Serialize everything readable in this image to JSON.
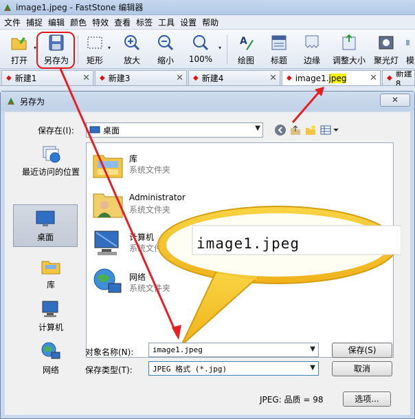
{
  "window": {
    "title": "image1.jpeg - FastStone 编辑器"
  },
  "menu": [
    "文件",
    "捕捉",
    "编辑",
    "颜色",
    "特效",
    "查看",
    "标签",
    "工具",
    "设置",
    "帮助"
  ],
  "toolbar": {
    "open": "打开",
    "saveas": "另存为",
    "rect": "矩形",
    "zoomin": "放大",
    "zoomout": "缩小",
    "zoom": "100%",
    "draw": "绘图",
    "caption": "标题",
    "edge": "边缘",
    "resize": "调整大小",
    "spotlight": "聚光灯",
    "more": "模"
  },
  "tabs": [
    {
      "name": "新建1"
    },
    {
      "name": "新建3"
    },
    {
      "name": "新建4"
    },
    {
      "name_plain": "image1.",
      "name_hl": "jpeg"
    },
    {
      "name": "新建8"
    }
  ],
  "dialog": {
    "title": "另存为",
    "close": "✕",
    "savein_label": "保存在(I):",
    "savein_value": "桌面",
    "places": [
      "最近访问的位置",
      "桌面",
      "库",
      "计算机",
      "网络"
    ],
    "files": [
      {
        "name": "库",
        "type": "系统文件夹"
      },
      {
        "name": "Administrator",
        "type": "系统文件夹"
      },
      {
        "name": "计算机",
        "type": "系统文件夹"
      },
      {
        "name": "网络",
        "type": "系统文件夹"
      }
    ],
    "callout_text": "image1.jpeg",
    "filename_label": "对象名称(N):",
    "filename_value": "image1.jpeg",
    "filetype_label": "保存类型(T):",
    "filetype_value": "JPEG 格式 (*.jpg)",
    "save_button": "保存(S)",
    "cancel_button": "取消",
    "options_button": "选项...",
    "quality": "JPEG: 品质 = 98"
  },
  "colors": {
    "highlight": "#e0181c",
    "arrow": "#e81e24",
    "callout_fill": "#fffef0",
    "callout_border": "#e2b800"
  }
}
